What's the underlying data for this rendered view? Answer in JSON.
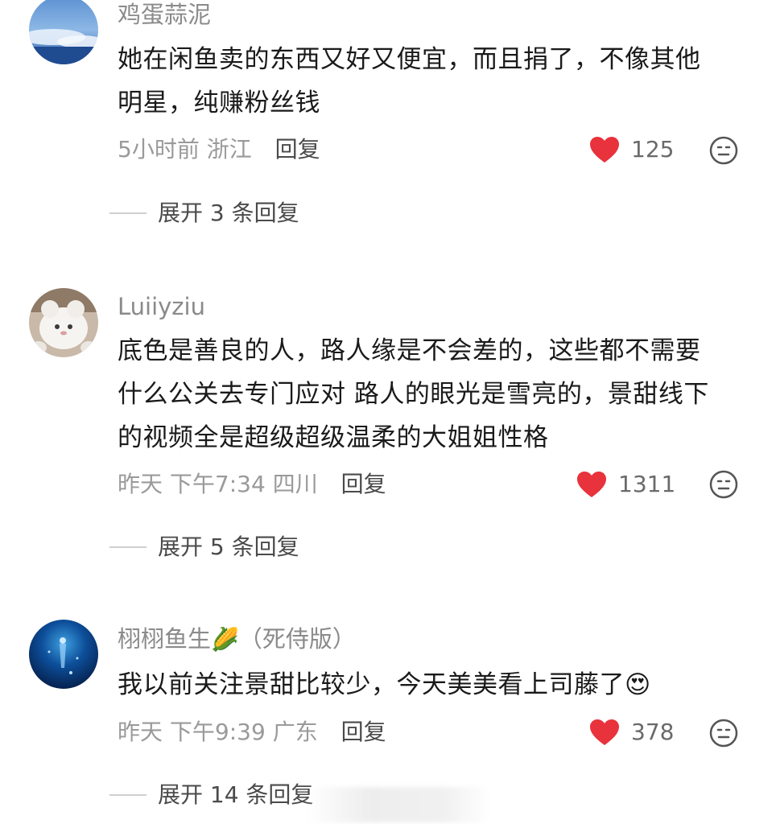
{
  "comments": [
    {
      "username": "鸡蛋蒜泥",
      "content_lines": [
        "她在闲鱼卖的东西又好又便宜，而且捐了，不像其他",
        "明星，纯赚粉丝钱"
      ],
      "time": "5小时前",
      "location": "浙江",
      "reply_label": "回复",
      "likes": "125",
      "expand_label": "展开 3 条回复",
      "avatar_icon": "sky-clouds-avatar"
    },
    {
      "username": "Luiiyziu",
      "content_lines": [
        "底色是善良的人，路人缘是不会差的，这些都不需要",
        "什么公关去专门应对 路人的眼光是雪亮的，景甜线下",
        "的视频全是超级超级温柔的大姐姐性格"
      ],
      "time": "昨天 下午7:34",
      "location": "四川",
      "reply_label": "回复",
      "likes": "1311",
      "expand_label": "展开 5 条回复",
      "avatar_icon": "plush-toy-avatar"
    },
    {
      "username": "栩栩鱼生",
      "username_emoji": "🌽",
      "username_suffix": "（死侍版）",
      "content_lines": [
        "我以前关注景甜比较少，今天美美看上司藤了"
      ],
      "content_emoji": "😍",
      "time": "昨天 下午9:39",
      "location": "广东",
      "reply_label": "回复",
      "likes": "378",
      "expand_label": "展开 14 条回复",
      "avatar_icon": "deep-sea-avatar"
    }
  ],
  "colors": {
    "heart": "#e8323c",
    "username": "#8a8a8a",
    "meta": "#9a9a9a",
    "reply": "#4a4a4a"
  }
}
